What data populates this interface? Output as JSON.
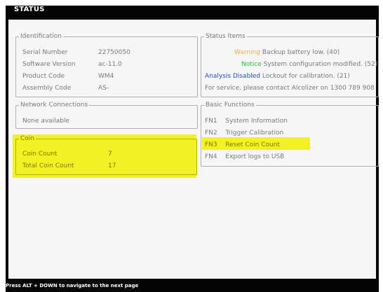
{
  "window": {
    "title": "STATUS",
    "footer_hint": "Press ALT + DOWN to navigate to the next page"
  },
  "identification": {
    "legend": "Identification",
    "rows": [
      {
        "label": "Serial Number",
        "value": "22750050"
      },
      {
        "label": "Software Version",
        "value": "ac-11.0"
      },
      {
        "label": "Product Code",
        "value": "WM4"
      },
      {
        "label": "Assembly Code",
        "value": "AS-"
      }
    ]
  },
  "status_items": {
    "legend": "Status Items",
    "items": [
      {
        "tag": "Warning",
        "message": "Backup battery low. (40)",
        "tag_color": "#f2b233"
      },
      {
        "tag": "Notice",
        "message": "System configuration modified. (52)",
        "tag_color": "#2fbf3a"
      },
      {
        "tag": "Analysis Disabled",
        "message": "Lockout for calibration. (21)",
        "tag_color": "#2a4fbf"
      },
      {
        "tag": "",
        "message": "For service, please contact Alcolizer on 1300 789 908"
      }
    ]
  },
  "network": {
    "legend": "Network Connections",
    "text": "None available"
  },
  "basic_functions": {
    "legend": "Basic Functions",
    "items": [
      {
        "key": "FN1",
        "label": "System Information"
      },
      {
        "key": "FN2",
        "label": "Trigger Calibration"
      },
      {
        "key": "FN3",
        "label": "Reset Coin Count"
      },
      {
        "key": "FN4",
        "label": "Export logs to USB"
      }
    ]
  },
  "coin": {
    "legend": "Coin",
    "rows": [
      {
        "label": "Coin Count",
        "value": "7"
      },
      {
        "label": "Total Coin Count",
        "value": "17"
      }
    ]
  },
  "colors": {
    "highlight": "#f3f124",
    "background": "#f6f6f6",
    "frame": "#050505"
  }
}
